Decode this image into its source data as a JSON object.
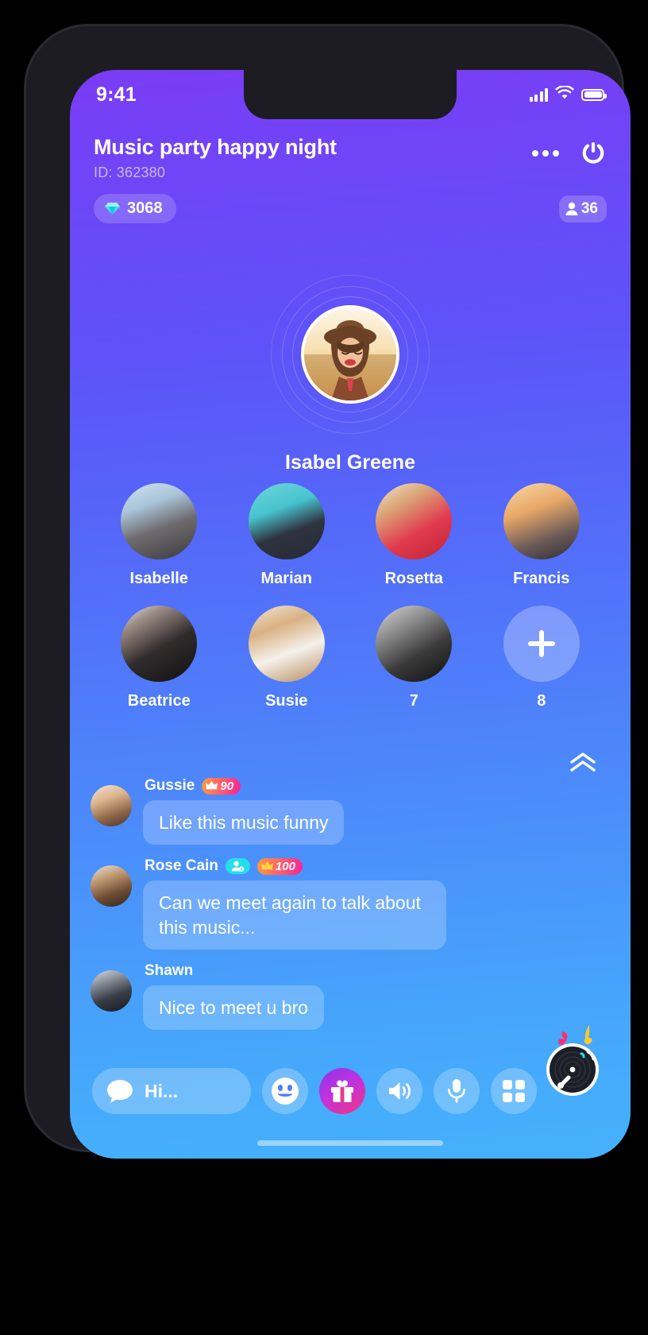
{
  "status_bar": {
    "time": "9:41",
    "signal_icon": "cellular-signal-icon",
    "wifi_icon": "wifi-icon",
    "battery_icon": "battery-full-icon"
  },
  "header": {
    "title": "Music party happy night",
    "room_id": "ID: 362380",
    "more_icon": "more-options-icon",
    "power_icon": "power-off-icon",
    "gems": {
      "icon": "diamond-icon",
      "count": "3068"
    },
    "viewers": {
      "icon": "person-icon",
      "count": "36"
    }
  },
  "host": {
    "name": "Isabel Greene",
    "avatar_icon": "host-avatar"
  },
  "participants": [
    {
      "name": "Isabelle",
      "photo": "ph-isabelle",
      "type": "user"
    },
    {
      "name": "Marian",
      "photo": "ph-marian",
      "type": "user"
    },
    {
      "name": "Rosetta",
      "photo": "ph-rosetta",
      "type": "user"
    },
    {
      "name": "Francis",
      "photo": "ph-francis",
      "type": "user"
    },
    {
      "name": "Beatrice",
      "photo": "ph-beatrice",
      "type": "user"
    },
    {
      "name": "Susie",
      "photo": "ph-susie",
      "type": "user"
    },
    {
      "name": "7",
      "photo": "ph-seven",
      "type": "user"
    },
    {
      "name": "8",
      "photo": "",
      "type": "empty-seat"
    }
  ],
  "collapse": {
    "icon": "chevron-double-up-icon"
  },
  "chat": {
    "messages": [
      {
        "user": "Gussie",
        "photo": "ph-gussie",
        "text": "Like this music funny",
        "level_badge": "90",
        "has_mod_badge": false
      },
      {
        "user": "Rose Cain",
        "photo": "ph-rose",
        "text": "Can we meet again to talk about this music...",
        "level_badge": "100",
        "has_mod_badge": true
      },
      {
        "user": "Shawn",
        "photo": "ph-shawn",
        "text": "Nice to meet u bro",
        "level_badge": "",
        "has_mod_badge": false
      }
    ]
  },
  "dj": {
    "icon": "turntable-music-icon"
  },
  "bottom_bar": {
    "chat_input": {
      "icon": "chat-bubble-icon",
      "placeholder": "Hi..."
    },
    "buttons": [
      {
        "name": "emoji-button",
        "icon": "smiley-face-icon"
      },
      {
        "name": "gift-button",
        "icon": "gift-box-icon"
      },
      {
        "name": "speaker-button",
        "icon": "speaker-volume-icon"
      },
      {
        "name": "mic-button",
        "icon": "microphone-icon"
      },
      {
        "name": "apps-button",
        "icon": "grid-apps-icon"
      }
    ]
  },
  "colors": {
    "gradient_top": "#7b3cf5",
    "gradient_bottom": "#45b2fc",
    "badge_gradient_start": "#ff9c3f",
    "badge_gradient_end": "#f6219c",
    "mod_badge": "#25dfe8",
    "gift_gradient_start": "#8f34f0",
    "gift_gradient_end": "#f2357f"
  }
}
